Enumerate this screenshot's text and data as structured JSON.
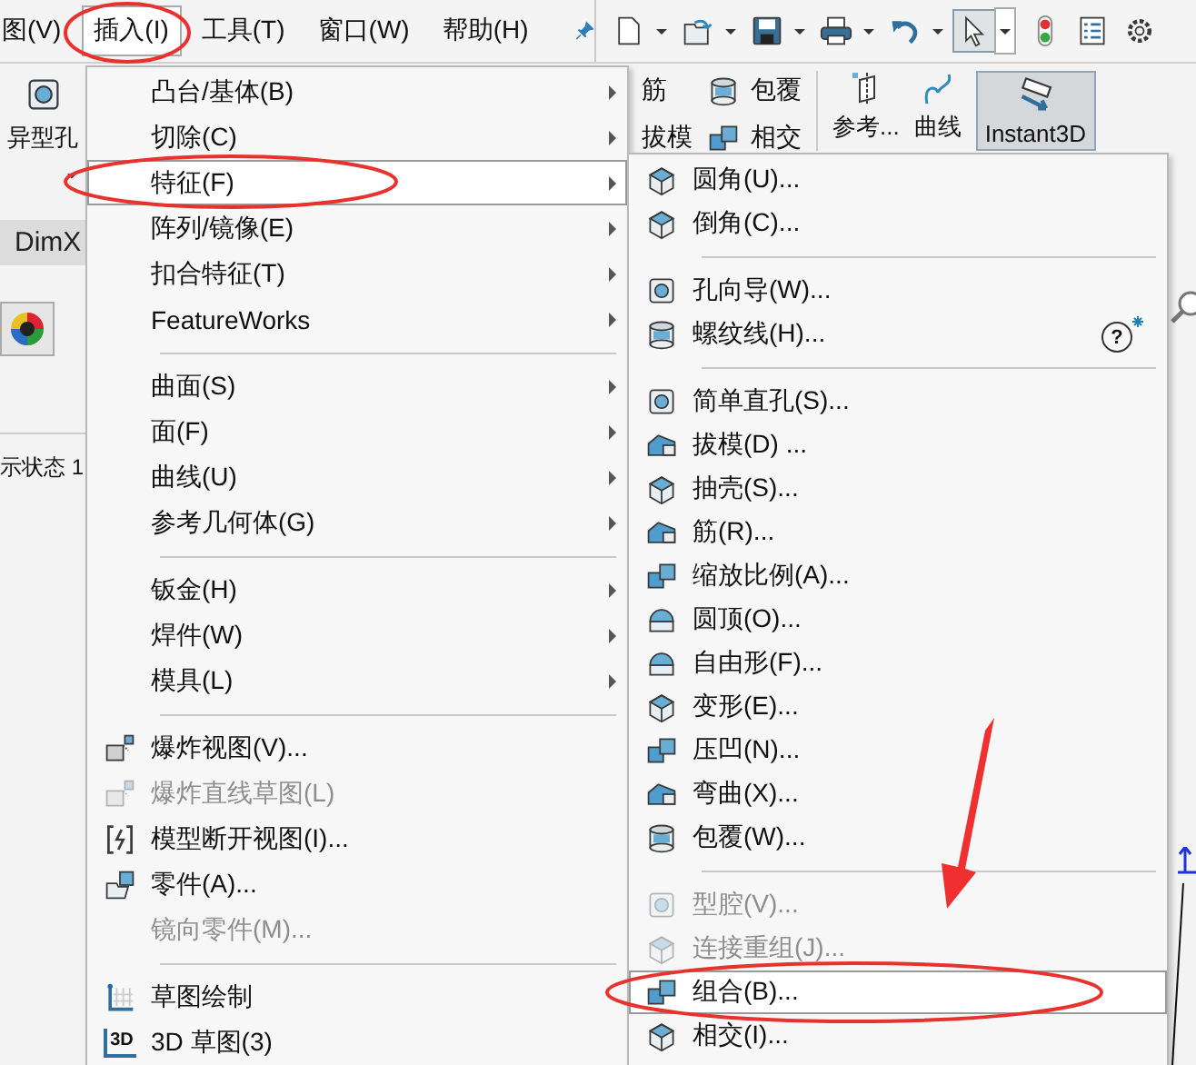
{
  "menu_bar": {
    "items": [
      {
        "label": "图(V)",
        "selected": false
      },
      {
        "label": "插入(I)",
        "selected": true
      },
      {
        "label": "工具(T)",
        "selected": false
      },
      {
        "label": "窗口(W)",
        "selected": false
      },
      {
        "label": "帮助(H)",
        "selected": false
      }
    ]
  },
  "toolbar": [
    {
      "kind": "new",
      "pressed": false,
      "dropdown": true
    },
    {
      "kind": "open",
      "pressed": false,
      "dropdown": true
    },
    {
      "kind": "save",
      "pressed": false,
      "dropdown": true
    },
    {
      "kind": "print",
      "pressed": false,
      "dropdown": true
    },
    {
      "kind": "undo",
      "pressed": false,
      "dropdown": true
    },
    {
      "kind": "select",
      "pressed": true,
      "dropdown": true
    },
    {
      "kind": "traffic",
      "pressed": false,
      "dropdown": false
    },
    {
      "kind": "list",
      "pressed": false,
      "dropdown": false
    },
    {
      "kind": "gear",
      "pressed": false,
      "dropdown": false
    }
  ],
  "ribbon": {
    "left_tool": "异型孔",
    "items": [
      {
        "label": "筋"
      },
      {
        "label": "包覆"
      },
      {
        "label": "拔模"
      },
      {
        "label": "相交"
      },
      {
        "label": "参考..."
      },
      {
        "label": "曲线"
      }
    ],
    "instant3d": {
      "label": "Instant3D",
      "pressed": true
    }
  },
  "tab": {
    "label": "DimX"
  },
  "status_text": "示状态 1",
  "menu": {
    "items": [
      {
        "kind": "submenu",
        "label": "凸台/基体(B)",
        "selected": false,
        "disabled": false
      },
      {
        "kind": "submenu",
        "label": "切除(C)",
        "selected": false,
        "disabled": false
      },
      {
        "kind": "submenu",
        "label": "特征(F)",
        "selected": true,
        "disabled": false
      },
      {
        "kind": "submenu",
        "label": "阵列/镜像(E)",
        "selected": false,
        "disabled": false
      },
      {
        "kind": "submenu",
        "label": "扣合特征(T)",
        "selected": false,
        "disabled": false
      },
      {
        "kind": "submenu",
        "label": "FeatureWorks",
        "selected": false,
        "disabled": false
      },
      {
        "kind": "separator"
      },
      {
        "kind": "submenu",
        "label": "曲面(S)",
        "selected": false,
        "disabled": false
      },
      {
        "kind": "submenu",
        "label": "面(F)",
        "selected": false,
        "disabled": false
      },
      {
        "kind": "submenu",
        "label": "曲线(U)",
        "selected": false,
        "disabled": false
      },
      {
        "kind": "submenu",
        "label": "参考几何体(G)",
        "selected": false,
        "disabled": false
      },
      {
        "kind": "separator"
      },
      {
        "kind": "submenu",
        "label": "钣金(H)",
        "selected": false,
        "disabled": false
      },
      {
        "kind": "submenu",
        "label": "焊件(W)",
        "selected": false,
        "disabled": false
      },
      {
        "kind": "submenu",
        "label": "模具(L)",
        "selected": false,
        "disabled": false
      },
      {
        "kind": "separator"
      },
      {
        "kind": "command",
        "label": "爆炸视图(V)...",
        "selected": false,
        "disabled": false
      },
      {
        "kind": "command",
        "label": "爆炸直线草图(L)",
        "selected": false,
        "disabled": true
      },
      {
        "kind": "command",
        "label": "模型断开视图(I)...",
        "selected": false,
        "disabled": false
      },
      {
        "kind": "command",
        "label": "零件(A)...",
        "selected": false,
        "disabled": false
      },
      {
        "kind": "command",
        "label": "镜向零件(M)...",
        "selected": false,
        "disabled": true
      },
      {
        "kind": "separator"
      },
      {
        "kind": "command",
        "label": "草图绘制",
        "selected": false,
        "disabled": false
      },
      {
        "kind": "command",
        "label": "3D 草图(3)",
        "selected": false,
        "disabled": false,
        "icon_text": "3D"
      }
    ]
  },
  "submenu": {
    "items": [
      {
        "kind": "command",
        "label": "圆角(U)...",
        "selected": false,
        "disabled": false
      },
      {
        "kind": "command",
        "label": "倒角(C)...",
        "selected": false,
        "disabled": false
      },
      {
        "kind": "separator"
      },
      {
        "kind": "command",
        "label": "孔向导(W)...",
        "selected": false,
        "disabled": false
      },
      {
        "kind": "command",
        "label": "螺纹线(H)...",
        "selected": false,
        "disabled": false,
        "help": "?"
      },
      {
        "kind": "separator"
      },
      {
        "kind": "command",
        "label": "简单直孔(S)...",
        "selected": false,
        "disabled": false
      },
      {
        "kind": "command",
        "label": "拔模(D) ...",
        "selected": false,
        "disabled": false
      },
      {
        "kind": "command",
        "label": "抽壳(S)...",
        "selected": false,
        "disabled": false
      },
      {
        "kind": "command",
        "label": "筋(R)...",
        "selected": false,
        "disabled": false
      },
      {
        "kind": "command",
        "label": "缩放比例(A)...",
        "selected": false,
        "disabled": false
      },
      {
        "kind": "command",
        "label": "圆顶(O)...",
        "selected": false,
        "disabled": false
      },
      {
        "kind": "command",
        "label": "自由形(F)...",
        "selected": false,
        "disabled": false
      },
      {
        "kind": "command",
        "label": "变形(E)...",
        "selected": false,
        "disabled": false
      },
      {
        "kind": "command",
        "label": "压凹(N)...",
        "selected": false,
        "disabled": false
      },
      {
        "kind": "command",
        "label": "弯曲(X)...",
        "selected": false,
        "disabled": false
      },
      {
        "kind": "command",
        "label": "包覆(W)...",
        "selected": false,
        "disabled": false
      },
      {
        "kind": "separator"
      },
      {
        "kind": "command",
        "label": "型腔(V)...",
        "selected": false,
        "disabled": true
      },
      {
        "kind": "command",
        "label": "连接重组(J)...",
        "selected": false,
        "disabled": true
      },
      {
        "kind": "command",
        "label": "组合(B)...",
        "selected": true,
        "disabled": false
      },
      {
        "kind": "command",
        "label": "相交(I)...",
        "selected": false,
        "disabled": false
      }
    ]
  }
}
